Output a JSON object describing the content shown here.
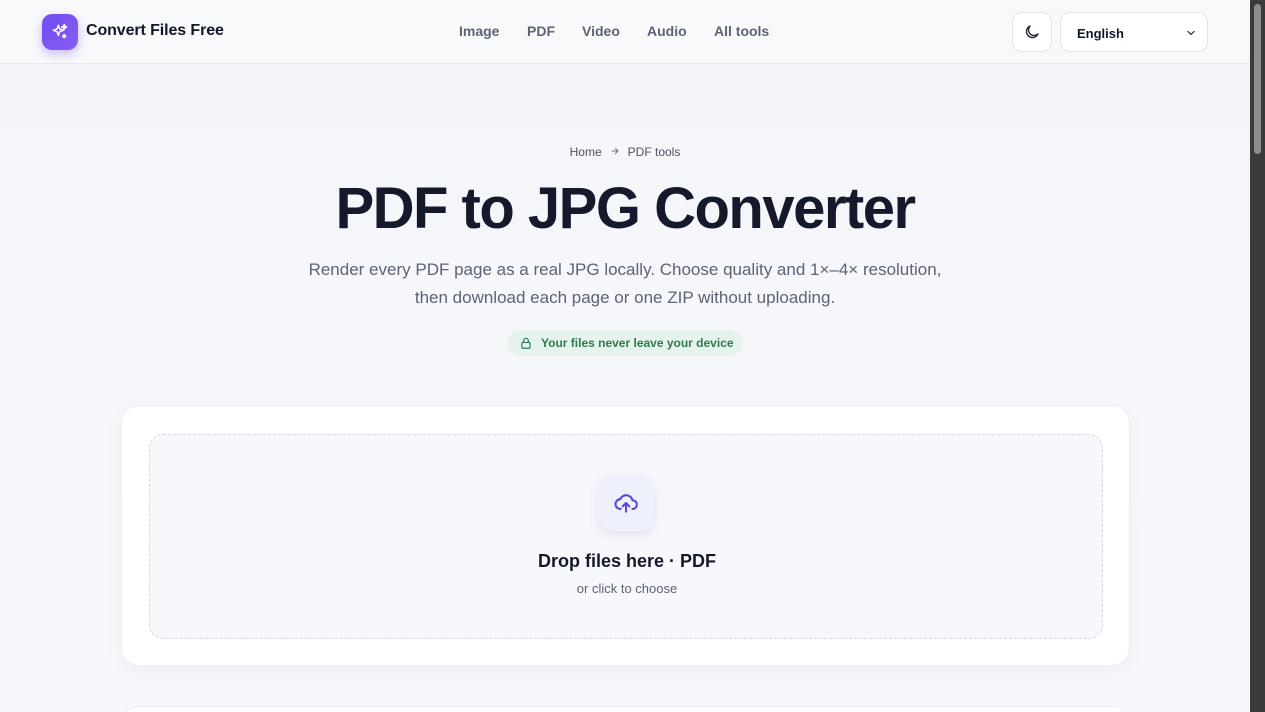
{
  "header": {
    "brand": "Convert Files Free",
    "nav": [
      "Image",
      "PDF",
      "Video",
      "Audio",
      "All tools"
    ],
    "language": "English"
  },
  "breadcrumb": {
    "home": "Home",
    "current": "PDF tools"
  },
  "hero": {
    "title": "PDF to JPG Converter",
    "subtitle_line1": "Render every PDF page as a real JPG locally. Choose quality and 1×–4× resolution,",
    "subtitle_line2": "then download each page or one ZIP without uploading.",
    "privacy_badge": "Your files never leave your device"
  },
  "upload": {
    "title": "Drop files here · PDF",
    "subtitle": "or click to choose"
  },
  "icons": {
    "logo": "sparkles-icon",
    "theme": "moon-icon",
    "language": "chevron-down-icon",
    "breadcrumb_sep": "arrow-right-icon",
    "privacy": "lock-icon",
    "upload": "cloud-upload-icon"
  },
  "colors": {
    "brand": "#7c4ff0",
    "privacy_bg": "#e6f3ec",
    "privacy_text": "#2f7a55",
    "upload_icon": "#5b46e0"
  }
}
